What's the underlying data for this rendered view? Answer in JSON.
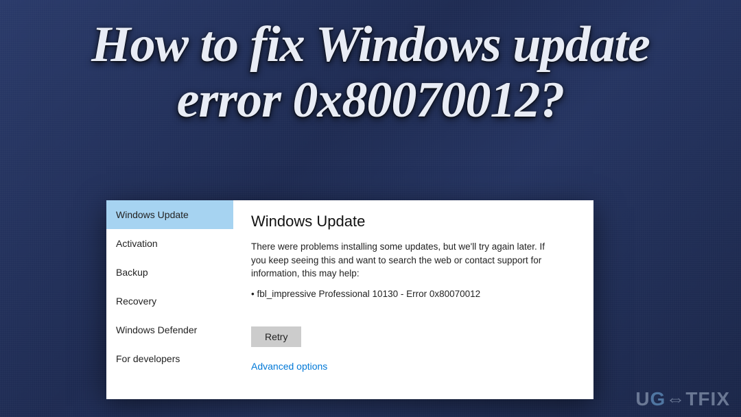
{
  "headline": "How to fix Windows update error 0x80070012?",
  "sidebar": {
    "items": [
      {
        "label": "Windows Update",
        "selected": true
      },
      {
        "label": "Activation",
        "selected": false
      },
      {
        "label": "Backup",
        "selected": false
      },
      {
        "label": "Recovery",
        "selected": false
      },
      {
        "label": "Windows Defender",
        "selected": false
      },
      {
        "label": "For developers",
        "selected": false
      }
    ]
  },
  "main": {
    "title": "Windows Update",
    "error_message": "There were problems installing some updates, but we'll try again later. If you keep seeing this and want to search the web or contact support for information, this may help:",
    "error_detail": "• fbl_impressive Professional 10130 - Error 0x80070012",
    "retry_label": "Retry",
    "advanced_label": "Advanced options"
  },
  "watermark": {
    "prefix": "U",
    "mid": "G",
    "arrow": "⇔",
    "suffix": "TFIX"
  }
}
